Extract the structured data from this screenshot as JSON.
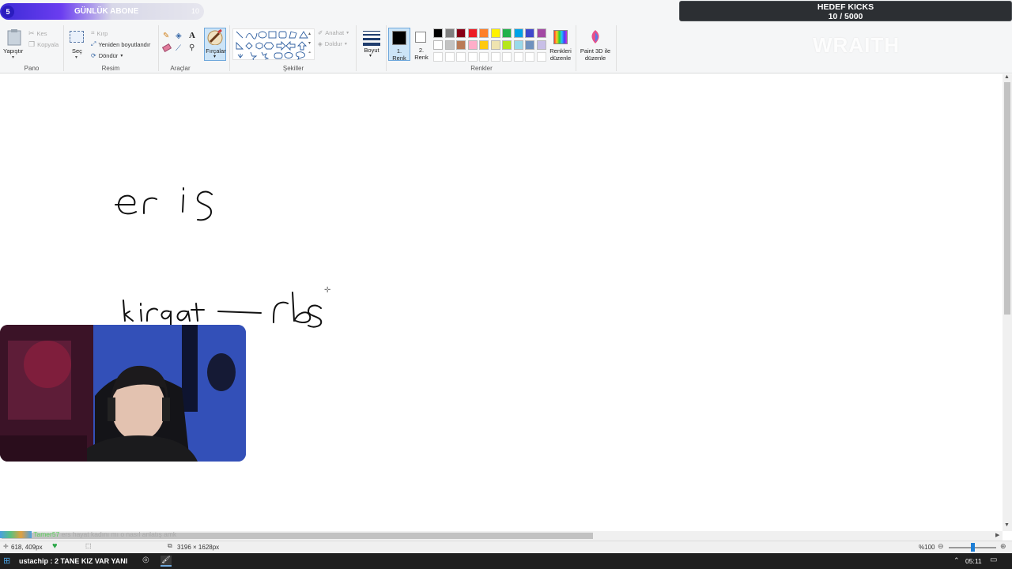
{
  "ribbon": {
    "pano": {
      "paste_label": "Yapıştır",
      "cut_label": "Kes",
      "copy_label": "Kopyala",
      "group_label": "Pano"
    },
    "resim": {
      "select_label": "Seç",
      "crop_label": "Kırp",
      "resize_label": "Yeniden boyutlandır",
      "rotate_label": "Döndür",
      "group_label": "Resim"
    },
    "araclar": {
      "brushes_label": "Fırçalar",
      "group_label": "Araçlar"
    },
    "sekiller": {
      "outline_label": "Anahat",
      "fill_label": "Doldur",
      "group_label": "Şekiller"
    },
    "boyut_label": "Boyut",
    "renkler": {
      "color1_label": "1.\nRenk",
      "color1_line1": "1.",
      "color1_line2": "Renk",
      "color2_line1": "2.",
      "color2_line2": "Renk",
      "edit_colors_line1": "Renkleri",
      "edit_colors_line2": "düzenle",
      "group_label": "Renkler",
      "palette_row1": [
        "#000000",
        "#7f7f7f",
        "#880015",
        "#ed1c24",
        "#ff7f27",
        "#fff200",
        "#22b14c",
        "#00a2e8",
        "#3f48cc",
        "#a349a4"
      ],
      "palette_row2": [
        "#ffffff",
        "#c3c3c3",
        "#b97a57",
        "#ffaec9",
        "#ffc90e",
        "#efe4b0",
        "#b5e61d",
        "#99d9ea",
        "#7092be",
        "#c8bfe7"
      ]
    },
    "paint3d_line1": "Paint 3D ile",
    "paint3d_line2": "düzenle"
  },
  "overlays": {
    "abone": {
      "number": "5",
      "title": "GÜNLÜK ABONE",
      "max": "10"
    },
    "kicks": {
      "title": "HEDEF KICKS",
      "value": "10 / 5000"
    },
    "watermark": "WRAITH"
  },
  "canvas": {
    "handwriting_line1": "er is",
    "handwriting_line2": "kirgat — rbs"
  },
  "chat": {
    "user": "Tamer57",
    "message": "ers hayat kadını mı o nasıl anlatış amk"
  },
  "statusbar": {
    "coords": "618, 409px",
    "image_size": "3196 × 1628px",
    "zoom": "%100"
  },
  "taskbar": {
    "event_text": "ustachip : 2 TANE KIZ VAR YANI",
    "clock": "05:11"
  }
}
